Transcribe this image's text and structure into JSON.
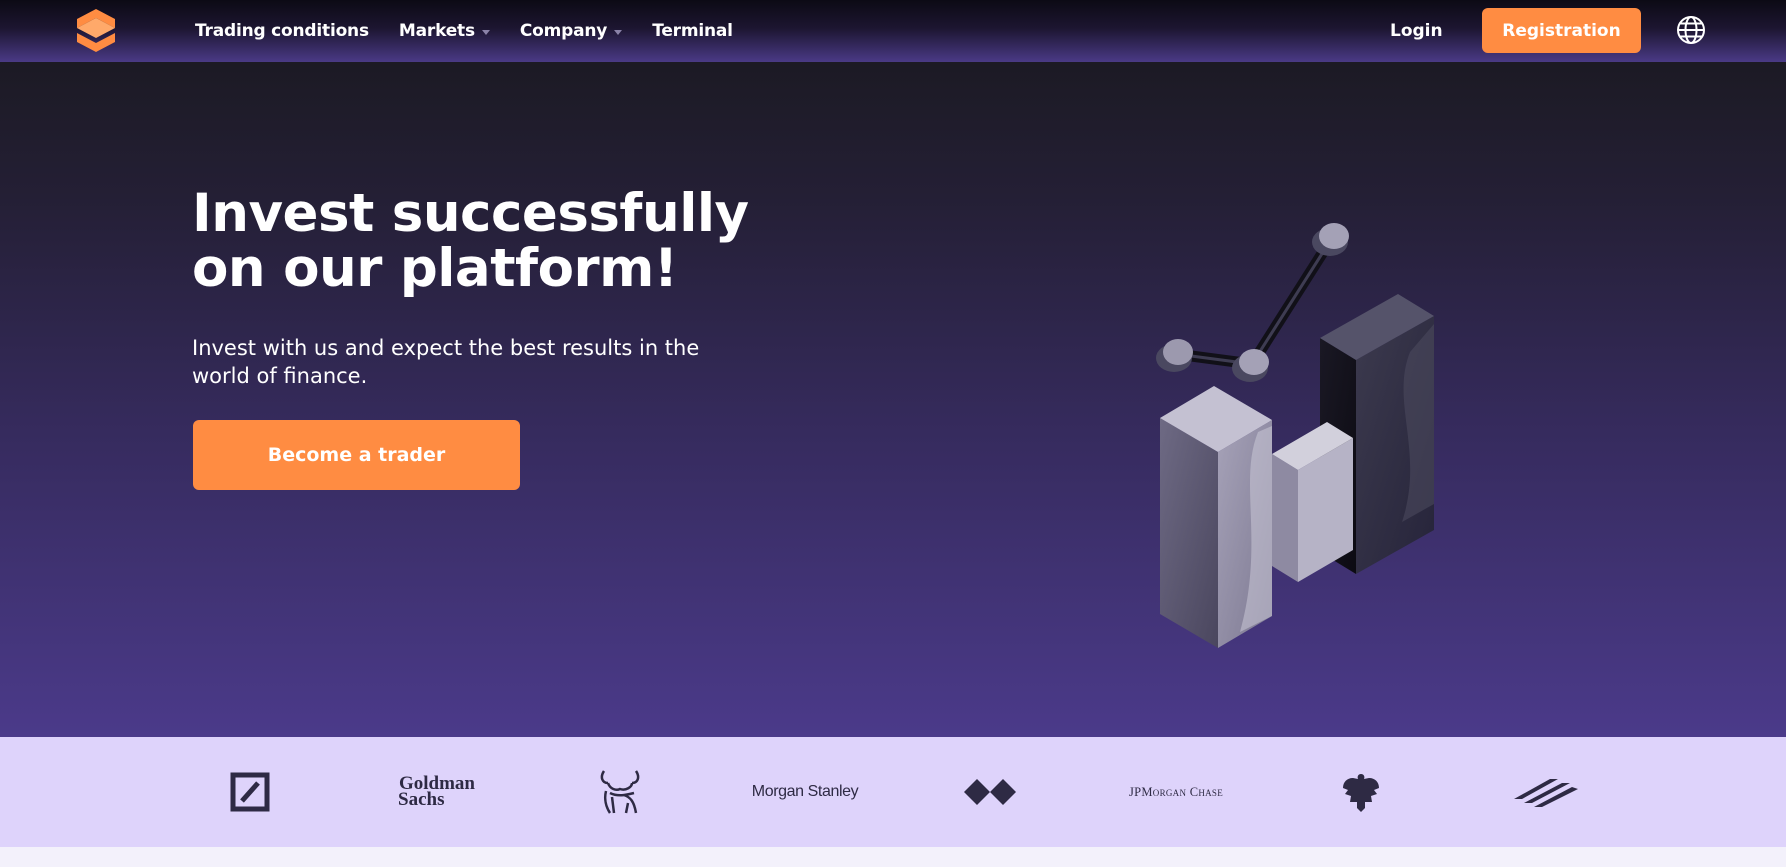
{
  "header": {
    "nav": [
      {
        "label": "Trading conditions",
        "dropdown": false
      },
      {
        "label": "Markets",
        "dropdown": true
      },
      {
        "label": "Company",
        "dropdown": true
      },
      {
        "label": "Terminal",
        "dropdown": false
      }
    ],
    "login_label": "Login",
    "register_label": "Registration",
    "icons": [
      "brand-logo-icon",
      "globe-icon",
      "chevron-down-icon"
    ]
  },
  "hero": {
    "title_line1": "Invest successfully",
    "title_line2": "on our platform!",
    "subtitle": "Invest with us and expect the best results in the world of finance.",
    "cta_label": "Become a trader"
  },
  "partners": [
    {
      "name": "deutsche-bank",
      "text": ""
    },
    {
      "name": "goldman-sachs",
      "line1": "Goldman",
      "line2": "Sachs"
    },
    {
      "name": "merrill-lynch-bull",
      "text": ""
    },
    {
      "name": "morgan-stanley",
      "text": "Morgan Stanley"
    },
    {
      "name": "hsbc",
      "text": ""
    },
    {
      "name": "jpmorgan-chase",
      "text": "JPMorgan Chase"
    },
    {
      "name": "barclays-eagle",
      "text": ""
    },
    {
      "name": "bank-of-america",
      "text": ""
    }
  ],
  "colors": {
    "accent": "#ff8c42",
    "hero_top": "#1c1a24",
    "hero_bottom": "#4b3a8a",
    "logos_bg": "#ded3fb",
    "logo_ink": "#2e2a44"
  }
}
